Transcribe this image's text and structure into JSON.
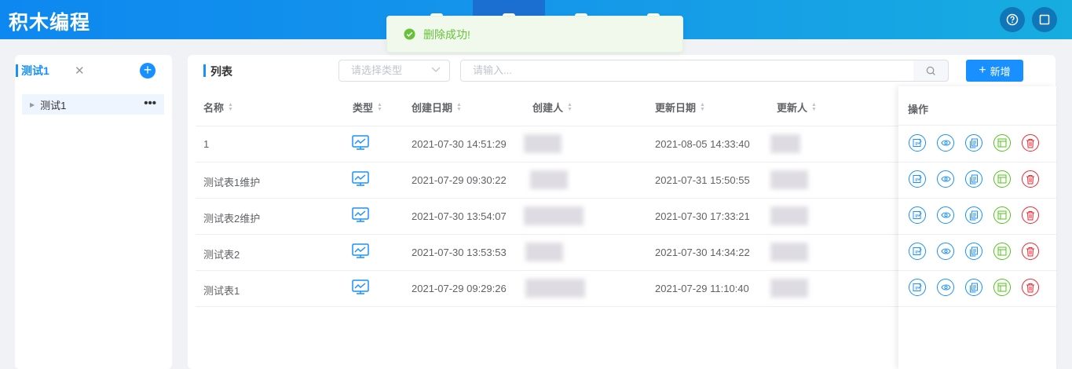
{
  "app": {
    "title": "积木编程"
  },
  "toast": {
    "message": "删除成功!"
  },
  "sidebar": {
    "tab_title": "测试1",
    "tree_items": [
      {
        "label": "测试1"
      }
    ]
  },
  "main": {
    "title": "列表",
    "type_select_placeholder": "请选择类型",
    "search_placeholder": "请输入...",
    "add_button_label": "新增"
  },
  "table": {
    "columns": [
      "名称",
      "类型",
      "创建日期",
      "创建人",
      "更新日期",
      "更新人",
      "操作"
    ],
    "rows": [
      {
        "name": "1",
        "created": "2021-07-30 14:51:29",
        "updated": "2021-08-05 14:33:40"
      },
      {
        "name": "测试表1维护",
        "created": "2021-07-29 09:30:22",
        "updated": "2021-07-31 15:50:55"
      },
      {
        "name": "测试表2维护",
        "created": "2021-07-30 13:54:07",
        "updated": "2021-07-30 17:33:21"
      },
      {
        "name": "测试表2",
        "created": "2021-07-30 13:53:53",
        "updated": "2021-07-30 14:34:22"
      },
      {
        "name": "测试表1",
        "created": "2021-07-29 09:29:26",
        "updated": "2021-07-29 11:10:40"
      }
    ]
  },
  "colors": {
    "primary": "#1890ff",
    "success": "#67c23a",
    "edit_icon": "#1890ff",
    "design_icon": "#52c41a",
    "delete_icon": "#f5222d"
  },
  "icons": {
    "type_icon": "chart-screen-icon",
    "row_actions": [
      "edit-icon",
      "preview-eye-icon",
      "copy-icon",
      "design-icon",
      "delete-trash-icon"
    ]
  }
}
